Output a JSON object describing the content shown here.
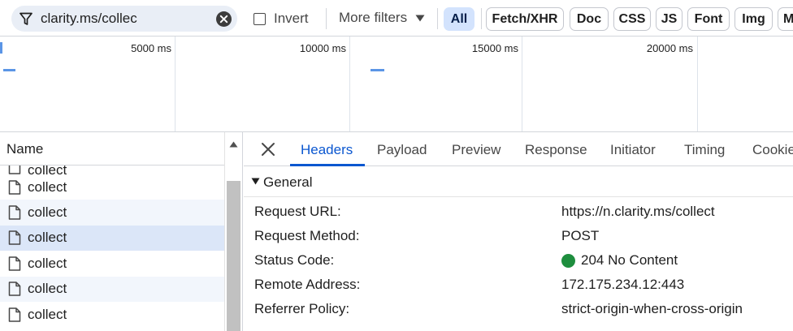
{
  "filter": {
    "value": "clarity.ms/collec",
    "invert_label": "Invert",
    "more_filters_label": "More filters"
  },
  "type_filters": [
    "All",
    "Fetch/XHR",
    "Doc",
    "CSS",
    "JS",
    "Font",
    "Img",
    "M"
  ],
  "active_type_filter": "All",
  "overview": {
    "ticks": [
      "5000 ms",
      "10000 ms",
      "15000 ms",
      "20000 ms"
    ]
  },
  "request_list": {
    "column_name": "Name",
    "rows": [
      "collect",
      "collect",
      "collect",
      "collect",
      "collect",
      "collect",
      "collect"
    ],
    "selected_index": 3
  },
  "detail": {
    "tabs": [
      "Headers",
      "Payload",
      "Preview",
      "Response",
      "Initiator",
      "Timing",
      "Cookies"
    ],
    "active_tab": "Headers",
    "section_title": "General",
    "general": {
      "request_url_label": "Request URL:",
      "request_url": "https://n.clarity.ms/collect",
      "request_method_label": "Request Method:",
      "request_method": "POST",
      "status_code_label": "Status Code:",
      "status_code": "204 No Content",
      "remote_address_label": "Remote Address:",
      "remote_address": "172.175.234.12:443",
      "referrer_policy_label": "Referrer Policy:",
      "referrer_policy": "strict-origin-when-cross-origin"
    }
  },
  "colors": {
    "accent": "#0b57d0",
    "chip_active_bg": "#d3e3fd",
    "status_ok": "#1e8e3e",
    "selected_row": "#dbe6f8"
  }
}
